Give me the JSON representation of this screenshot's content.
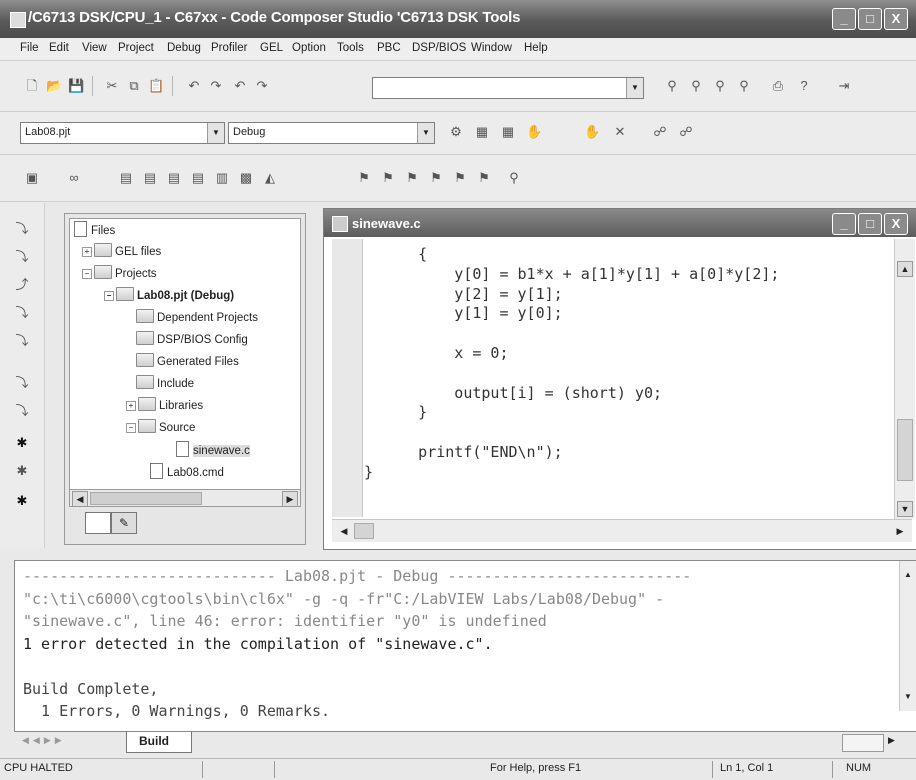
{
  "window": {
    "title": "/C6713 DSK/CPU_1 - C67xx - Code Composer Studio 'C6713 DSK Tools",
    "buttons": [
      "_",
      "□",
      "X"
    ]
  },
  "menu": [
    "File",
    "Edit",
    "View",
    "Project",
    "Debug",
    "Profiler",
    "GEL",
    "Option",
    "Tools",
    "PBC",
    "DSP/BIOS",
    "Window",
    "Help"
  ],
  "toolbar2": {
    "project_combo": "Lab08.pjt",
    "config_combo": "Debug"
  },
  "file_tree": {
    "items": [
      {
        "label": "Files"
      },
      {
        "label": "GEL files"
      },
      {
        "label": "Projects"
      },
      {
        "label": "Lab08.pjt (Debug)"
      },
      {
        "label": "Dependent Projects"
      },
      {
        "label": "DSP/BIOS Config"
      },
      {
        "label": "Generated Files"
      },
      {
        "label": "Include"
      },
      {
        "label": "Libraries"
      },
      {
        "label": "Source"
      },
      {
        "label": "sinewave.c"
      },
      {
        "label": "Lab08.cmd"
      }
    ]
  },
  "editor": {
    "title": "sinewave.c",
    "lines": [
      "      {",
      "          y[0] = b1*x + a[1]*y[1] + a[0]*y[2];",
      "          y[2] = y[1];",
      "          y[1] = y[0];",
      "",
      "          x = 0;",
      "",
      "          output[i] = (short) y0;",
      "      }",
      "",
      "      printf(\"END\\n\");",
      "}"
    ]
  },
  "output": {
    "lines": [
      "---------------------------- Lab08.pjt - Debug ---------------------------",
      "\"c:\\ti\\c6000\\cgtools\\bin\\cl6x\" -g -q -fr\"C:/LabVIEW Labs/Lab08/Debug\" -",
      "\"sinewave.c\", line 46: error: identifier \"y0\" is undefined",
      "1 error detected in the compilation of \"sinewave.c\".",
      "",
      "Build Complete,",
      "  1 Errors, 0 Warnings, 0 Remarks."
    ],
    "tab": "Build"
  },
  "status": {
    "state": "CPU HALTED",
    "help": "For Help, press F1",
    "position": "Ln 1, Col 1",
    "num": "NUM"
  }
}
